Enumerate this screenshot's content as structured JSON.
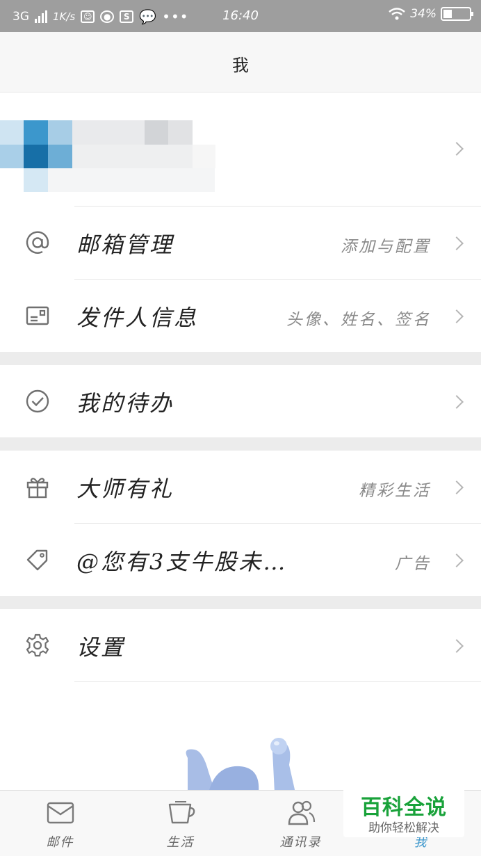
{
  "status_bar": {
    "network": "3G",
    "speed": "1K/s",
    "time": "16:40",
    "battery": "34%"
  },
  "header": {
    "title": "我"
  },
  "menu": [
    {
      "label": "邮箱管理",
      "sub": "添加与配置",
      "icon": "at-icon"
    },
    {
      "label": "发件人信息",
      "sub": "头像、姓名、签名",
      "icon": "id-card-icon"
    },
    {
      "label": "我的待办",
      "sub": "",
      "icon": "check-circle-icon"
    },
    {
      "label": "大师有礼",
      "sub": "精彩生活",
      "icon": "gift-icon"
    },
    {
      "label": "@您有3支牛股未…",
      "sub": "广告",
      "icon": "tag-icon"
    },
    {
      "label": "设置",
      "sub": "",
      "icon": "gear-icon"
    }
  ],
  "tabs": [
    {
      "label": "邮件",
      "icon": "mail-icon"
    },
    {
      "label": "生活",
      "icon": "cup-icon"
    },
    {
      "label": "通讯录",
      "icon": "contacts-icon"
    },
    {
      "label": "我",
      "icon": "profile-icon"
    }
  ],
  "watermark": {
    "brand": "百科全说",
    "tagline": "助你轻松解决"
  },
  "colors": {
    "accent": "#19a23a",
    "status_bar": "#9e9e9e",
    "separator": "#ececec"
  }
}
